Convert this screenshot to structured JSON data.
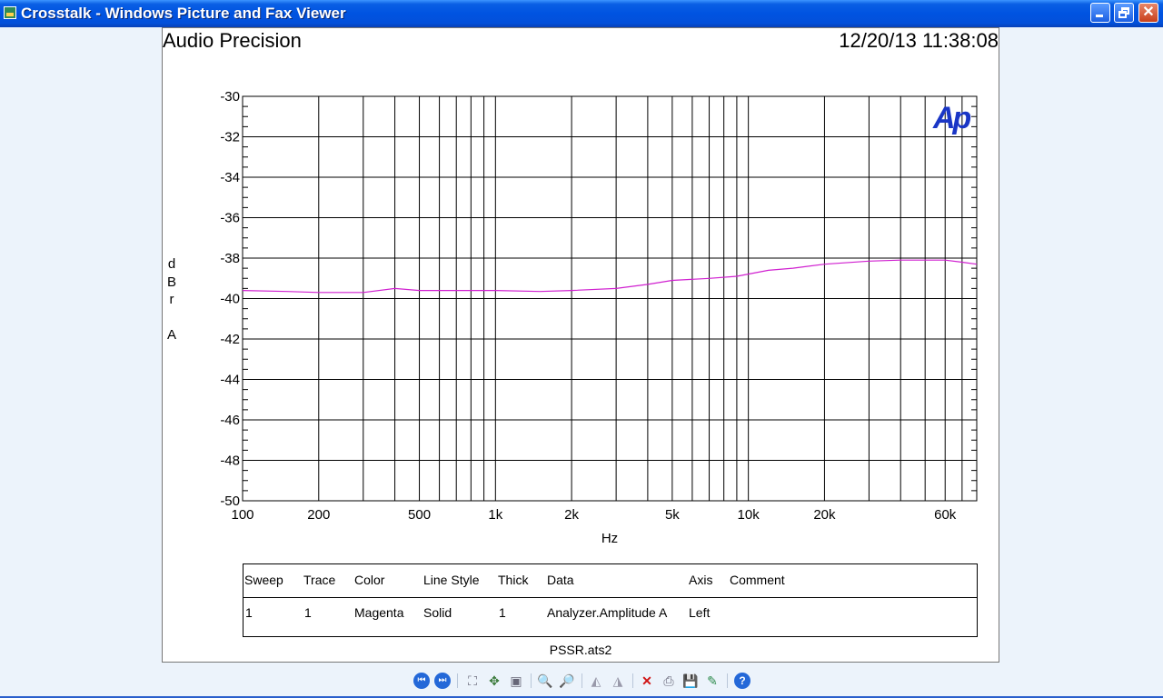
{
  "window": {
    "title": "Crosstalk - Windows Picture and Fax Viewer"
  },
  "image": {
    "header_left": "Audio Precision",
    "header_right": "12/20/13 11:38:08",
    "y_label_letters": [
      "d",
      "B",
      "r",
      "",
      "A"
    ],
    "logo_text": "Ap",
    "footer_filename": "PSSR.ats2"
  },
  "chart_data": {
    "type": "line",
    "xlabel": "Hz",
    "ylabel": "dBr A",
    "x_scale": "log",
    "xlim": [
      100,
      80000
    ],
    "ylim": [
      -50,
      -30
    ],
    "x_ticks": [
      100,
      200,
      500,
      1000,
      2000,
      5000,
      10000,
      20000,
      60000
    ],
    "x_tick_labels": [
      "100",
      "200",
      "500",
      "1k",
      "2k",
      "5k",
      "10k",
      "20k",
      "60k"
    ],
    "y_ticks": [
      -30,
      -32,
      -34,
      -36,
      -38,
      -40,
      -42,
      -44,
      -46,
      -48,
      -50
    ],
    "y_tick_labels": [
      "-30",
      "-32",
      "-34",
      "-36",
      "-38",
      "-40",
      "-42",
      "-44",
      "-46",
      "-48",
      "-50"
    ],
    "grid": true,
    "series": [
      {
        "color": "#D020D0",
        "x": [
          100,
          150,
          200,
          300,
          400,
          500,
          700,
          1000,
          1500,
          2000,
          3000,
          4000,
          5000,
          7000,
          9000,
          12000,
          15000,
          20000,
          30000,
          40000,
          50000,
          60000,
          70000,
          80000
        ],
        "y": [
          -39.6,
          -39.65,
          -39.7,
          -39.7,
          -39.5,
          -39.6,
          -39.6,
          -39.6,
          -39.65,
          -39.6,
          -39.5,
          -39.3,
          -39.1,
          -39.0,
          -38.9,
          -38.6,
          -38.5,
          -38.3,
          -38.15,
          -38.1,
          -38.1,
          -38.1,
          -38.2,
          -38.3
        ]
      }
    ]
  },
  "legend": {
    "headers": [
      "Sweep",
      "Trace",
      "Color",
      "Line Style",
      "Thick",
      "Data",
      "Axis",
      "Comment"
    ],
    "rows": [
      [
        "1",
        "1",
        "Magenta",
        "Solid",
        "1",
        "Analyzer.Amplitude A",
        "Left",
        ""
      ]
    ]
  },
  "toolbar": {
    "items": [
      "previous-image",
      "next-image",
      "best-fit",
      "actual-size",
      "slideshow",
      "zoom-in",
      "zoom-out",
      "rotate-clockwise",
      "rotate-counterclockwise",
      "delete",
      "print",
      "save-as",
      "open-for-editing",
      "help"
    ]
  }
}
